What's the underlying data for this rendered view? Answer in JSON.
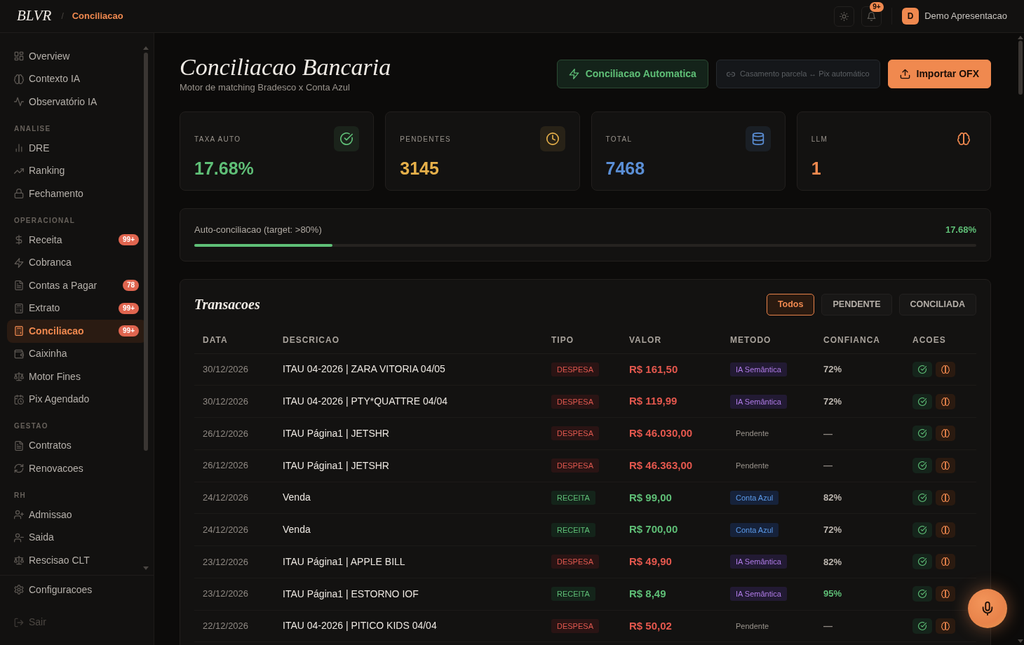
{
  "topbar": {
    "logo": "BLVR",
    "separator": "/",
    "breadcrumb": "Conciliacao",
    "notification_count": "9+",
    "user_initial": "D",
    "user_name": "Demo Apresentacao"
  },
  "sidebar": {
    "sections": [
      {
        "items": [
          {
            "label": "Overview",
            "selected": false
          },
          {
            "label": "Contexto IA",
            "selected": false
          },
          {
            "label": "Observatório IA",
            "selected": false
          }
        ]
      },
      {
        "title": "ANALISE",
        "items": [
          {
            "label": "DRE",
            "selected": false
          },
          {
            "label": "Ranking",
            "selected": false
          },
          {
            "label": "Fechamento",
            "selected": false
          }
        ]
      },
      {
        "title": "OPERACIONAL",
        "items": [
          {
            "label": "Receita",
            "selected": false,
            "badge": "99+"
          },
          {
            "label": "Cobranca",
            "selected": false
          },
          {
            "label": "Contas a Pagar",
            "selected": false,
            "badge": "78"
          },
          {
            "label": "Extrato",
            "selected": false,
            "badge": "99+"
          },
          {
            "label": "Conciliacao",
            "selected": true,
            "badge": "99+"
          },
          {
            "label": "Caixinha",
            "selected": false
          },
          {
            "label": "Motor Fines",
            "selected": false
          },
          {
            "label": "Pix Agendado",
            "selected": false
          }
        ]
      },
      {
        "title": "GESTAO",
        "items": [
          {
            "label": "Contratos",
            "selected": false
          },
          {
            "label": "Renovacoes",
            "selected": false
          }
        ]
      },
      {
        "title": "RH",
        "items": [
          {
            "label": "Admissao",
            "selected": false
          },
          {
            "label": "Saida",
            "selected": false
          },
          {
            "label": "Rescisao CLT",
            "selected": false
          }
        ]
      }
    ],
    "footer_items": [
      {
        "label": "Configuracoes",
        "disabled": false
      },
      {
        "label": "Sair",
        "disabled": true
      }
    ]
  },
  "header": {
    "title": "Conciliacao Bancaria",
    "subtitle": "Motor de matching Bradesco x Conta Azul",
    "actions": [
      {
        "label": "Conciliacao Automatica",
        "kind": "success",
        "disabled": false
      },
      {
        "label": "Casamento parcela ↔ Pix automático",
        "kind": "link",
        "disabled": true
      },
      {
        "label": "Importar OFX",
        "kind": "primary",
        "disabled": false
      }
    ]
  },
  "stats": [
    {
      "label": "TAXA AUTO",
      "value": "17.68%",
      "kind": "rate",
      "color": "#5fbf77"
    },
    {
      "label": "PENDENTES",
      "value": "3145",
      "kind": "pending",
      "color": "#e6b04a"
    },
    {
      "label": "TOTAL",
      "value": "7468",
      "kind": "total",
      "color": "#5b8fd6"
    },
    {
      "label": "LLM",
      "value": "1",
      "kind": "llm",
      "color": "#f0894f"
    }
  ],
  "progress": {
    "label": "Auto-conciliacao (target: >80%)",
    "value": "17.68%",
    "level": 0.1768
  },
  "transactions": {
    "title": "Transacoes",
    "filters": [
      {
        "label": "Todos",
        "selected": true
      },
      {
        "label": "PENDENTE",
        "selected": false
      },
      {
        "label": "CONCILIADA",
        "selected": false
      }
    ],
    "columns": [
      "DATA",
      "DESCRICAO",
      "TIPO",
      "VALOR",
      "METODO",
      "CONFIANCA",
      "ACOES"
    ],
    "rows": [
      {
        "date": "30/12/2026",
        "description": "ITAU 04-2026 | ZARA VITORIA 04/05",
        "type": {
          "label": "DESPESA",
          "kind": "expense"
        },
        "value": "R$ 161,50",
        "method": {
          "label": "IA Semântica",
          "kind": "ai"
        },
        "confidence": {
          "label": "72%",
          "kind": "normal"
        }
      },
      {
        "date": "30/12/2026",
        "description": "ITAU 04-2026 | PTY*QUATTRE 04/04",
        "type": {
          "label": "DESPESA",
          "kind": "expense"
        },
        "value": "R$ 119,99",
        "method": {
          "label": "IA Semântica",
          "kind": "ai"
        },
        "confidence": {
          "label": "72%",
          "kind": "normal"
        }
      },
      {
        "date": "26/12/2026",
        "description": "ITAU Página1 | JETSHR",
        "type": {
          "label": "DESPESA",
          "kind": "expense"
        },
        "value": "R$ 46.030,00",
        "method": {
          "label": "Pendente",
          "kind": "pending"
        },
        "confidence": {
          "label": "—",
          "kind": "empty"
        }
      },
      {
        "date": "26/12/2026",
        "description": "ITAU Página1 | JETSHR",
        "type": {
          "label": "DESPESA",
          "kind": "expense"
        },
        "value": "R$ 46.363,00",
        "method": {
          "label": "Pendente",
          "kind": "pending"
        },
        "confidence": {
          "label": "—",
          "kind": "empty"
        }
      },
      {
        "date": "24/12/2026",
        "description": "Venda",
        "type": {
          "label": "RECEITA",
          "kind": "income"
        },
        "value": "R$ 99,00",
        "method": {
          "label": "Conta Azul",
          "kind": "conta_azul"
        },
        "confidence": {
          "label": "82%",
          "kind": "normal"
        }
      },
      {
        "date": "24/12/2026",
        "description": "Venda",
        "type": {
          "label": "RECEITA",
          "kind": "income"
        },
        "value": "R$ 700,00",
        "method": {
          "label": "Conta Azul",
          "kind": "conta_azul"
        },
        "confidence": {
          "label": "72%",
          "kind": "normal"
        }
      },
      {
        "date": "23/12/2026",
        "description": "ITAU Página1 | APPLE BILL",
        "type": {
          "label": "DESPESA",
          "kind": "expense"
        },
        "value": "R$ 49,90",
        "method": {
          "label": "IA Semântica",
          "kind": "ai"
        },
        "confidence": {
          "label": "82%",
          "kind": "normal"
        }
      },
      {
        "date": "23/12/2026",
        "description": "ITAU Página1 | ESTORNO IOF",
        "type": {
          "label": "RECEITA",
          "kind": "income"
        },
        "value": "R$ 8,49",
        "method": {
          "label": "IA Semântica",
          "kind": "ai"
        },
        "confidence": {
          "label": "95%",
          "kind": "high"
        }
      },
      {
        "date": "22/12/2026",
        "description": "ITAU 04-2026 | PITICO KIDS 04/04",
        "type": {
          "label": "DESPESA",
          "kind": "expense"
        },
        "value": "R$ 50,02",
        "method": {
          "label": "Pendente",
          "kind": "pending"
        },
        "confidence": {
          "label": "—",
          "kind": "empty"
        }
      }
    ]
  }
}
